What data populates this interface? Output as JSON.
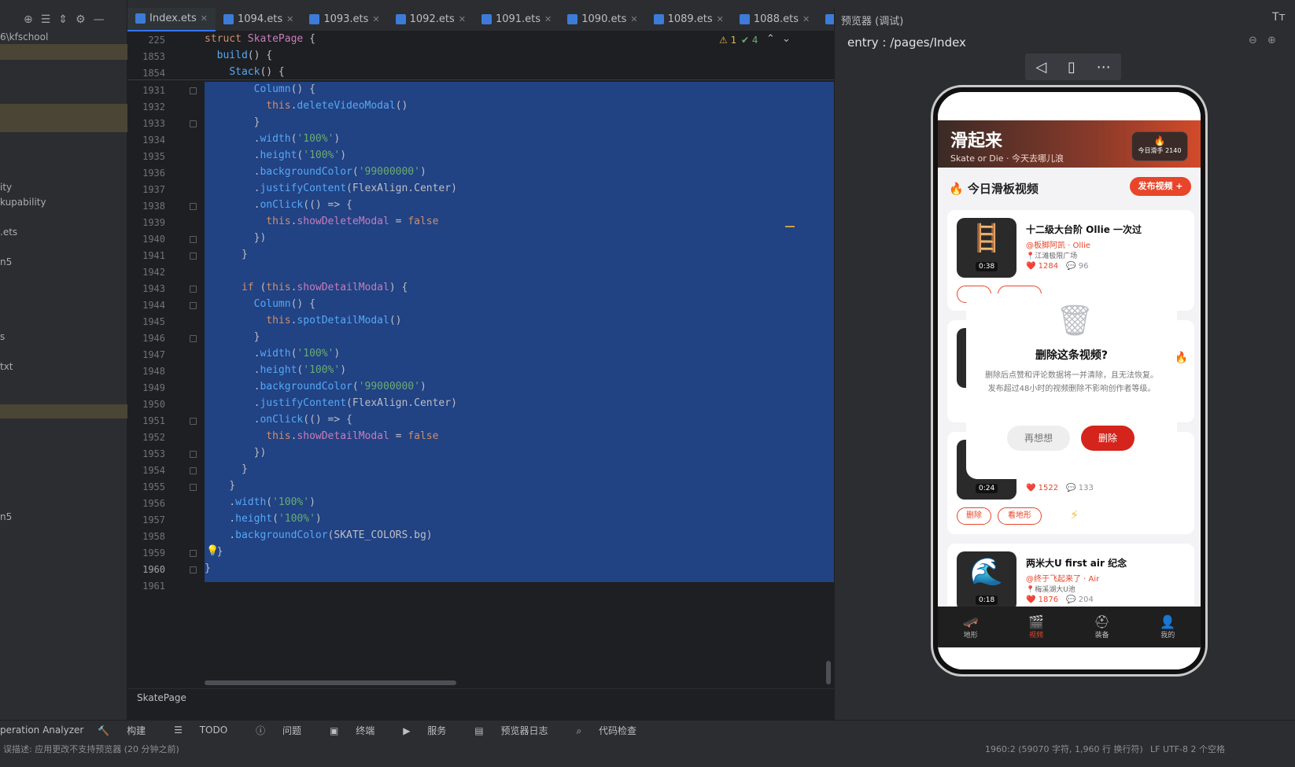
{
  "left_panel": {
    "items": [
      "6\\kfschool",
      "ity",
      "kupability",
      ".ets",
      "n5",
      "s",
      "txt",
      "n5"
    ]
  },
  "tabs": [
    "Index.ets",
    "1094.ets",
    "1093.ets",
    "1092.ets",
    "1091.ets",
    "1090.ets",
    "1089.ets",
    "1088.ets",
    "10"
  ],
  "editor": {
    "warnings": "1",
    "checks": "4",
    "sticky": [
      {
        "ln": "225",
        "text": "struct SkatePage {"
      },
      {
        "ln": "1853",
        "text": "  build() {"
      },
      {
        "ln": "1854",
        "text": "    Stack() {"
      }
    ],
    "lines": [
      {
        "ln": "1931",
        "text": "        Column() {"
      },
      {
        "ln": "1932",
        "text": "          this.deleteVideoModal()"
      },
      {
        "ln": "1933",
        "text": "        }"
      },
      {
        "ln": "1934",
        "text": "        .width('100%')"
      },
      {
        "ln": "1935",
        "text": "        .height('100%')"
      },
      {
        "ln": "1936",
        "text": "        .backgroundColor('99000000')"
      },
      {
        "ln": "1937",
        "text": "        .justifyContent(FlexAlign.Center)"
      },
      {
        "ln": "1938",
        "text": "        .onClick(() => {"
      },
      {
        "ln": "1939",
        "text": "          this.showDeleteModal = false"
      },
      {
        "ln": "1940",
        "text": "        })"
      },
      {
        "ln": "1941",
        "text": "      }"
      },
      {
        "ln": "1942",
        "text": ""
      },
      {
        "ln": "1943",
        "text": "      if (this.showDetailModal) {"
      },
      {
        "ln": "1944",
        "text": "        Column() {"
      },
      {
        "ln": "1945",
        "text": "          this.spotDetailModal()"
      },
      {
        "ln": "1946",
        "text": "        }"
      },
      {
        "ln": "1947",
        "text": "        .width('100%')"
      },
      {
        "ln": "1948",
        "text": "        .height('100%')"
      },
      {
        "ln": "1949",
        "text": "        .backgroundColor('99000000')"
      },
      {
        "ln": "1950",
        "text": "        .justifyContent(FlexAlign.Center)"
      },
      {
        "ln": "1951",
        "text": "        .onClick(() => {"
      },
      {
        "ln": "1952",
        "text": "          this.showDetailModal = false"
      },
      {
        "ln": "1953",
        "text": "        })"
      },
      {
        "ln": "1954",
        "text": "      }"
      },
      {
        "ln": "1955",
        "text": "    }"
      },
      {
        "ln": "1956",
        "text": "    .width('100%')"
      },
      {
        "ln": "1957",
        "text": "    .height('100%')"
      },
      {
        "ln": "1958",
        "text": "    .backgroundColor(SKATE_COLORS.bg)"
      },
      {
        "ln": "1959",
        "text": "  }"
      },
      {
        "ln": "1960",
        "text": "}"
      },
      {
        "ln": "1961",
        "text": ""
      }
    ],
    "breadcrumb": "SkatePage"
  },
  "preview": {
    "title": "预览器 (调试)",
    "route": "entry : /pages/Index",
    "app": {
      "title": "滑起来",
      "subtitle": "Skate or Die · 今天去哪儿浪",
      "badge": "今日滑手 2140",
      "section": "今日滑板视频",
      "publish": "发布视频 +",
      "cards": [
        {
          "title": "十二级大台阶 Ollie 一次过",
          "author": "@板脚阿凯 · Ollie",
          "loc": "📍江滩极限广场",
          "likes": "1284",
          "comments": "96",
          "dur": "0:38",
          "emoji": "🪜"
        },
        {
          "title": "",
          "author": "",
          "loc": "",
          "likes": "1522",
          "comments": "133",
          "dur": "0:24",
          "emoji": ""
        },
        {
          "title": "两米大U first air 纪念",
          "author": "@终于飞起来了 · Air",
          "loc": "📍梅溪湖大U池",
          "likes": "1876",
          "comments": "204",
          "dur": "0:18",
          "emoji": "🌊"
        }
      ],
      "pill_delete": "删除",
      "pill_view": "看地形",
      "modal": {
        "title": "删除这条视频?",
        "desc": "删除后点赞和评论数据将一并清除，且无法恢复。发布超过48小时的视频删除不影响创作者等级。",
        "cancel": "再想想",
        "confirm": "删除"
      },
      "nav": [
        "地形",
        "视频",
        "装备",
        "我的"
      ]
    }
  },
  "toolwindows": [
    "peration Analyzer",
    "构建",
    "TODO",
    "问题",
    "终端",
    "服务",
    "预览器日志",
    "代码检查"
  ],
  "status": {
    "message": "误描述: 应用更改不支持预览器 (20 分钟之前)",
    "position": "1960:2 (59070 字符, 1,960 行 换行符)",
    "encoding": "LF  UTF-8  2 个空格"
  }
}
